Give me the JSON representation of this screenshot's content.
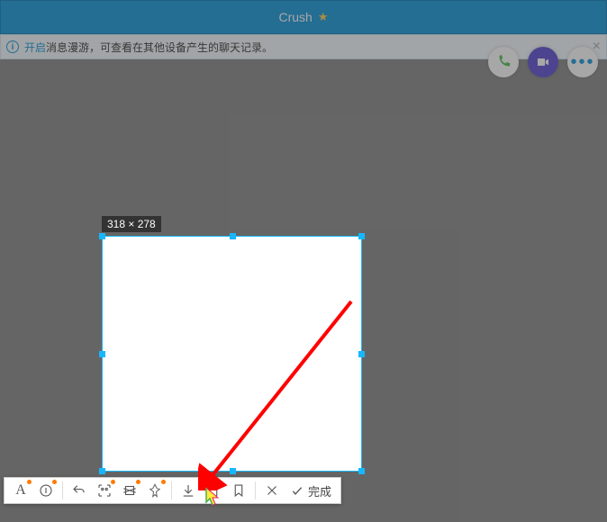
{
  "titlebar": {
    "name": "Crush",
    "star": "★"
  },
  "notice": {
    "link_text": "开启",
    "text": "消息漫游，可查看在其他设备产生的聊天记录。",
    "close": "×",
    "info": "i"
  },
  "topbtns": {
    "dots": "•••"
  },
  "screenshot": {
    "dimensions": "318 × 278"
  },
  "toolbar": {
    "text_tool": "A",
    "done_label": "完成"
  }
}
